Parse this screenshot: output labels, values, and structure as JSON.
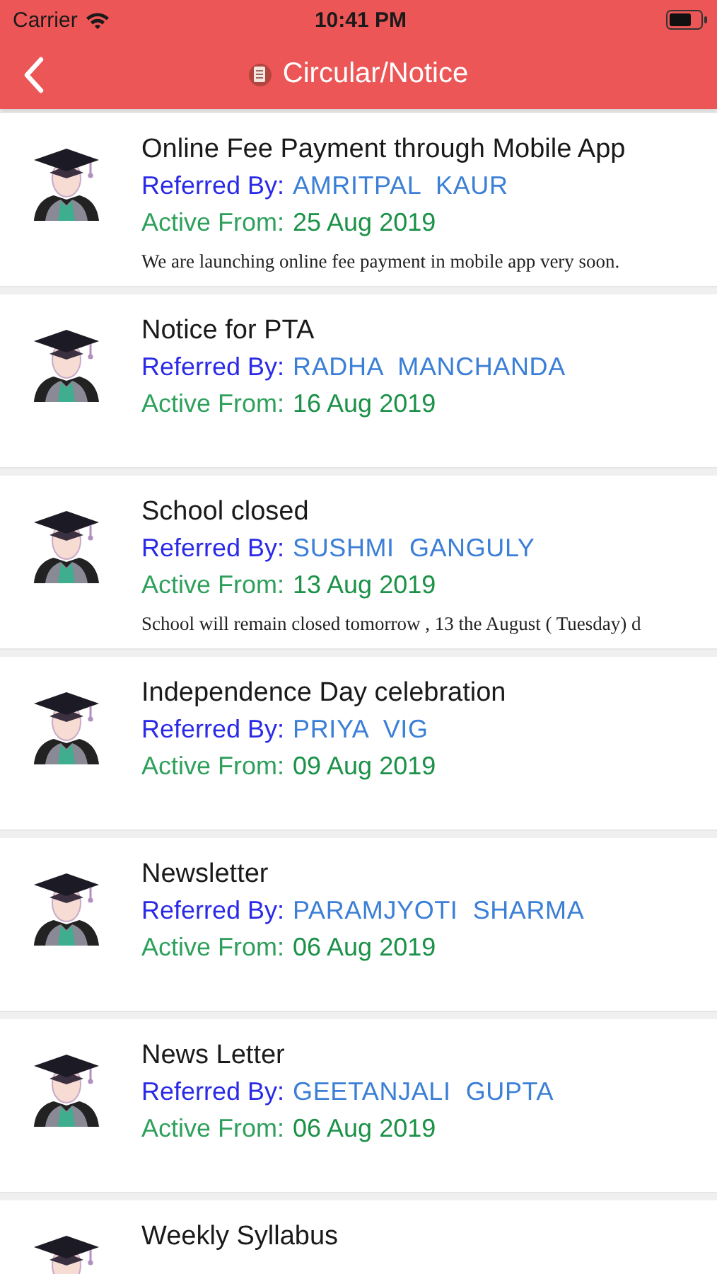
{
  "status_bar": {
    "carrier": "Carrier",
    "time": "10:41 PM"
  },
  "nav": {
    "title": "Circular/Notice"
  },
  "notices": [
    {
      "title": "Online Fee Payment through Mobile App",
      "referred_label": "Referred By:",
      "referred_by": "AMRITPAL  KAUR",
      "active_label": "Active From:",
      "active_from": "25 Aug 2019",
      "description": "We are launching online fee payment in mobile app very soon."
    },
    {
      "title": "Notice for PTA",
      "referred_label": "Referred By:",
      "referred_by": "RADHA  MANCHANDA",
      "active_label": "Active From:",
      "active_from": "16 Aug 2019"
    },
    {
      "title": "School closed",
      "referred_label": "Referred By:",
      "referred_by": "SUSHMI  GANGULY",
      "active_label": "Active From:",
      "active_from": "13 Aug 2019",
      "description": "School will remain closed tomorrow , 13 the August ( Tuesday) d"
    },
    {
      "title": "Independence Day celebration",
      "referred_label": "Referred By:",
      "referred_by": "PRIYA  VIG",
      "active_label": "Active From:",
      "active_from": "09 Aug 2019"
    },
    {
      "title": "Newsletter",
      "referred_label": "Referred By:",
      "referred_by": "PARAMJYOTI  SHARMA",
      "active_label": "Active From:",
      "active_from": "06 Aug 2019"
    },
    {
      "title": "News Letter",
      "referred_label": "Referred By:",
      "referred_by": "GEETANJALI  GUPTA",
      "active_label": "Active From:",
      "active_from": "06 Aug 2019"
    },
    {
      "title": "Weekly Syllabus"
    }
  ]
}
